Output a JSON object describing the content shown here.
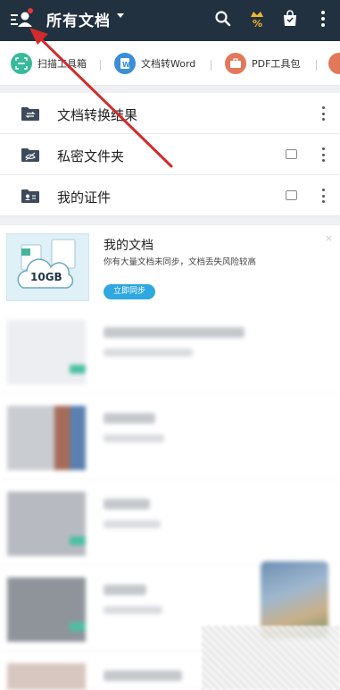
{
  "header": {
    "title": "所有文档",
    "icons": [
      "menu-user-icon",
      "search-icon",
      "vip-percent-icon",
      "bag-icon",
      "more-vertical-icon"
    ],
    "colors": {
      "bar": "#22313f",
      "vip": "#f2b632",
      "notify_dot": "#e53935"
    }
  },
  "tools": [
    {
      "label": "扫描工具箱",
      "icon": "scan-icon",
      "color": "#38b99a"
    },
    {
      "label": "文档转Word",
      "icon": "word-icon",
      "color": "#3b8fd6"
    },
    {
      "label": "PDF工具包",
      "icon": "pdf-toolbox-icon",
      "color": "#e2785a"
    }
  ],
  "folders": [
    {
      "label": "文档转换结果",
      "icon": "convert-folder-icon"
    },
    {
      "label": "私密文件夹",
      "icon": "private-folder-icon"
    },
    {
      "label": "我的证件",
      "icon": "id-card-folder-icon"
    }
  ],
  "banner": {
    "thumb_text": "10GB",
    "title": "我的文档",
    "subtitle": "你有大量文档未同步，文档丢失风险较高",
    "button": "立即同步",
    "close": "×",
    "accent": "#2fa7e0"
  },
  "annotation": {
    "color": "#d22b2b"
  }
}
